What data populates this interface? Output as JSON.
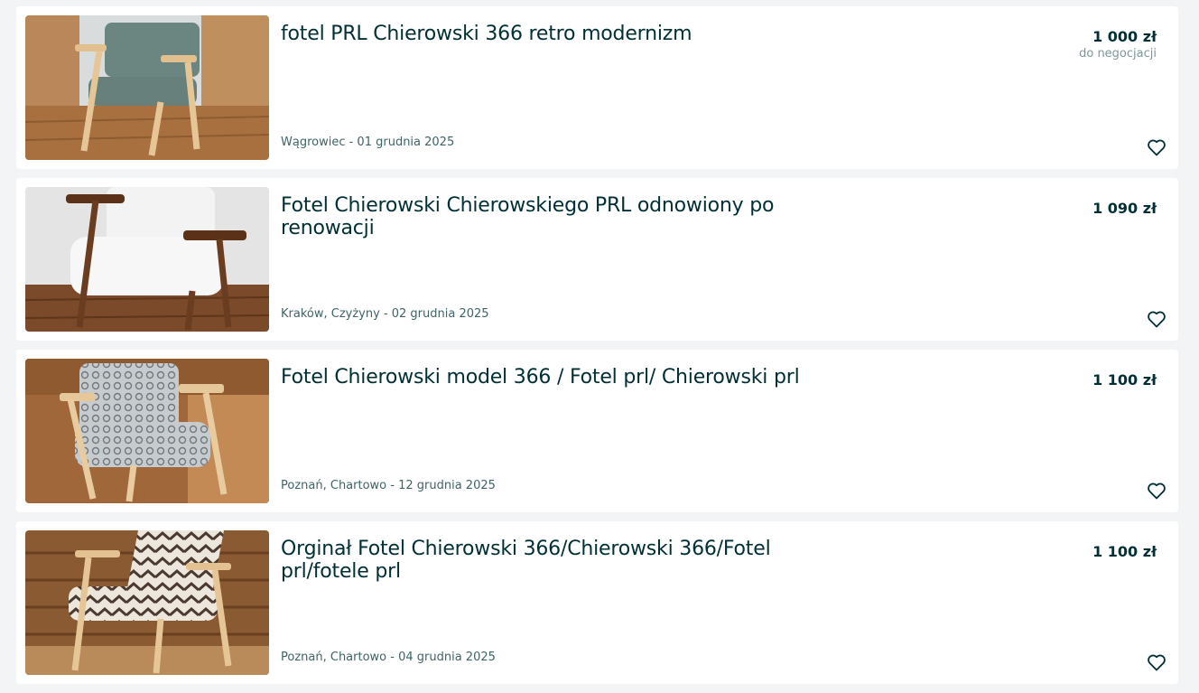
{
  "listings": [
    {
      "title": "fotel PRL Chierowski 366 retro modernizm",
      "location_date": "Wągrowiec - 01 grudnia 2025",
      "price": "1 000 zł",
      "price_note": "do negocjacji",
      "image_icon": "teal-armchair-photo"
    },
    {
      "title": "Fotel Chierowski Chierowskiego PRL odnowiony po renowacji",
      "location_date": "Kraków, Czyżyny - 02 grudnia 2025",
      "price": "1 090 zł",
      "price_note": "",
      "image_icon": "white-armchair-photo"
    },
    {
      "title": "Fotel Chierowski model 366 / Fotel prl/ Chierowski prl",
      "location_date": "Poznań, Chartowo - 12 grudnia 2025",
      "price": "1 100 zł",
      "price_note": "",
      "image_icon": "pattern-armchair-photo"
    },
    {
      "title": "Orginał Fotel Chierowski 366/Chierowski 366/Fotel prl/fotele prl",
      "location_date": "Poznań, Chartowo - 04 grudnia 2025",
      "price": "1 100 zł",
      "price_note": "",
      "image_icon": "chevron-armchair-photo"
    }
  ],
  "icons": {
    "favorite": "heart-icon"
  },
  "colors": {
    "text_primary": "#002f34",
    "text_secondary": "#406367",
    "text_muted": "#7f9799",
    "background": "#f2f4f5",
    "card": "#ffffff"
  }
}
